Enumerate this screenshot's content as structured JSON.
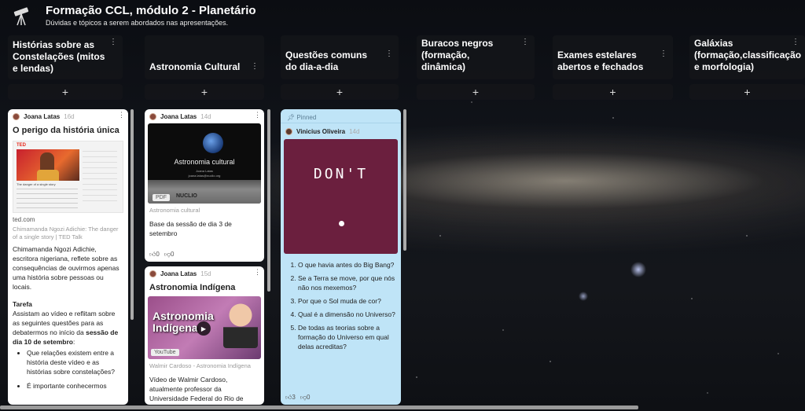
{
  "header": {
    "title": "Formação CCL, módulo 2 - Planetário",
    "subtitle": "Dúvidas e tópicos a serem abordados nas apresentações.",
    "logo_icon": "telescope-icon"
  },
  "columns": [
    {
      "title": "Histórias sobre as Constelações (mitos e lendas)",
      "add": "+"
    },
    {
      "title": "Astronomia Cultural",
      "add": "+"
    },
    {
      "title": "Questões comuns do dia-a-dia",
      "add": "+"
    },
    {
      "title": "Buracos negros (formação, dinâmica)",
      "add": "+"
    },
    {
      "title": "Exames estelares abertos e fechados",
      "add": "+"
    },
    {
      "title": "Galáxias (formação,classificação e morfologia)",
      "add": "+"
    }
  ],
  "posts": {
    "p1": {
      "author": "Joana Latas",
      "time": "16d",
      "title": "O perigo da história única",
      "preview_logo": "TED",
      "preview_video_caption": "The danger of a single story",
      "link_domain": "ted.com",
      "link_title": "Chimamanda Ngozi Adichie: The danger of a single story | TED Talk",
      "body": "Chimamanda Ngozi Adichie, escritora nigeriana, reflete sobre as consequências de ouvirmos apenas uma história sobre pessoas ou locais.",
      "task_title": "Tarefa",
      "task_text_1": "Assistam ao vídeo e reflitam sobre as seguintes questões para as debatermos no início da ",
      "task_text_bold": "sessão de dia 10 de setembro",
      "task_text_2": ":",
      "bullets": [
        "Que relações existem entre a história deste vídeo e as histórias sobre constelações?",
        "É importante conhecermos"
      ]
    },
    "p2": {
      "author": "Joana Latas",
      "time": "14d",
      "thumb_title": "Astronomia cultural",
      "thumb_sub1": "Joana Latas",
      "thumb_sub2": "joana.latas@nuclio.org",
      "thumb_badge": "NUCLIO",
      "file_type": "PDF",
      "source": "Astronomia cultural",
      "body": "Base da sessão de dia 3 de setembro",
      "likes": "0",
      "dislikes": "0"
    },
    "p3": {
      "author": "Joana Latas",
      "time": "15d",
      "title": "Astronomia Indígena",
      "thumb_text": "Astronomia Indígena",
      "file_type": "YouTube",
      "source": "Walmir Cardoso - Astronomia Indígena",
      "body": "Vídeo de Walmir Cardoso, atualmente professor da Universidade Federal do Rio de"
    },
    "p4": {
      "pinned": "Pinned",
      "author": "Vinicius Oliveira",
      "time": "14d",
      "image_text": "DON'T",
      "questions": [
        "O que havia antes do Big Bang?",
        "Se a Terra se move, por que nós não nos mexemos?",
        "Por que o Sol muda de cor?",
        "Qual é a dimensão no Universo?",
        "De todas as teorias sobre a formação do Universo em qual delas acreditas?"
      ],
      "likes": "3",
      "dislikes": "0"
    }
  }
}
